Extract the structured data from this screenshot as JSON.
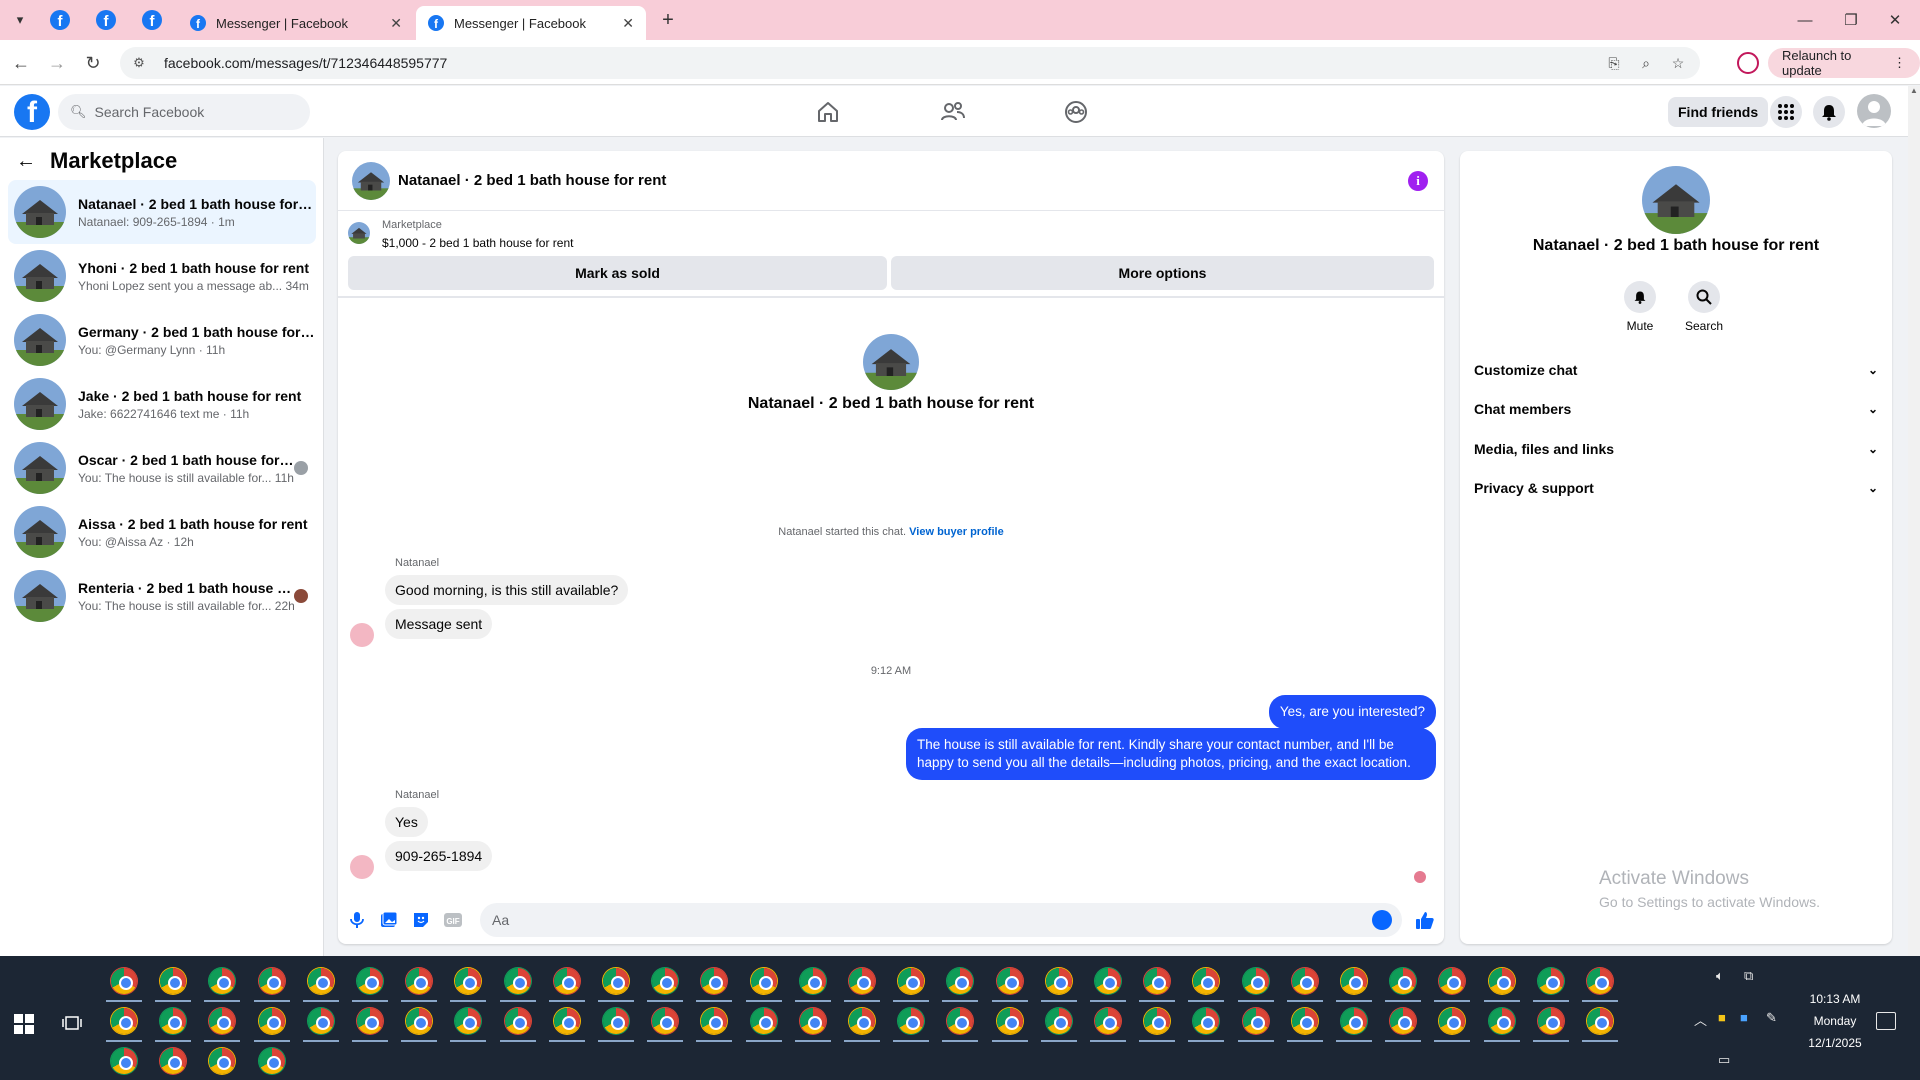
{
  "browser": {
    "tabs": [
      {
        "title": "Messenger | Facebook",
        "active": false
      },
      {
        "title": "Messenger | Facebook",
        "active": true
      }
    ],
    "url": "facebook.com/messages/t/712346448595777",
    "relaunch_label": "Relaunch to update"
  },
  "header": {
    "search_placeholder": "Search Facebook",
    "find_friends_label": "Find friends"
  },
  "sidebar": {
    "title": "Marketplace",
    "conversations": [
      {
        "name": "Natanael · 2 bed 1 bath house for r...",
        "preview": "Natanael: 909-265-1894 · 1m",
        "active": true
      },
      {
        "name": "Yhoni · 2 bed 1 bath house for rent",
        "preview": "Yhoni Lopez sent you a message ab...  34m",
        "active": false
      },
      {
        "name": "Germany · 2 bed 1 bath house for r...",
        "preview": "You: @Germany Lynn · 11h",
        "active": false
      },
      {
        "name": "Jake · 2 bed 1 bath house for rent",
        "preview": "Jake: 6622741646 text me · 11h",
        "active": false
      },
      {
        "name": "Oscar · 2 bed 1 bath house for r...",
        "preview": "You: The house is still available for...  11h",
        "active": false
      },
      {
        "name": "Aissa · 2 bed 1 bath house for rent",
        "preview": "You: @Aissa Az · 12h",
        "active": false
      },
      {
        "name": "Renteria · 2 bed 1 bath house fo...",
        "preview": "You: The house is still available for...  22h",
        "active": false
      }
    ]
  },
  "chat": {
    "title": "Natanael · 2 bed 1 bath house for rent",
    "listing": {
      "category": "Marketplace",
      "price_title": "$1,000 - 2 bed 1 bath house for rent",
      "mark_sold_label": "Mark as sold",
      "more_options_label": "More options"
    },
    "intro_name": "Natanael · 2 bed 1 bath house for rent",
    "started_text": "Natanael started this chat.",
    "view_buyer_profile": "View buyer profile",
    "messages": [
      {
        "sender": "Natanael",
        "direction": "in",
        "text": "Good morning, is this still available?"
      },
      {
        "direction": "in",
        "text": "Message sent"
      },
      {
        "direction": "out",
        "text": "Yes, are you interested?"
      },
      {
        "direction": "out",
        "text": "The house is still available for rent. Kindly share your contact number, and I'll be happy to send you all the details—including photos, pricing, and the exact location."
      },
      {
        "sender": "Natanael",
        "direction": "in",
        "text": "Yes"
      },
      {
        "direction": "in",
        "text": "909-265-1894"
      }
    ],
    "timestamp": "9:12 AM",
    "composer_placeholder": "Aa"
  },
  "right_panel": {
    "name": "Natanael · 2 bed 1 bath house for rent",
    "actions": [
      {
        "label": "Mute"
      },
      {
        "label": "Search"
      }
    ],
    "sections": [
      {
        "label": "Customize chat"
      },
      {
        "label": "Chat members"
      },
      {
        "label": "Media, files and links"
      },
      {
        "label": "Privacy & support"
      }
    ]
  },
  "watermark": {
    "line1": "Activate Windows",
    "line2": "Go to Settings to activate Windows."
  },
  "taskbar": {
    "time": "10:13 AM",
    "day": "Monday",
    "date": "12/1/2025"
  },
  "colors": {
    "fb_blue": "#1877f2",
    "outgoing_bubble": "#1f4dfa",
    "tabbar_bg": "#f8cdd8",
    "taskbar_bg": "#1c2634"
  }
}
